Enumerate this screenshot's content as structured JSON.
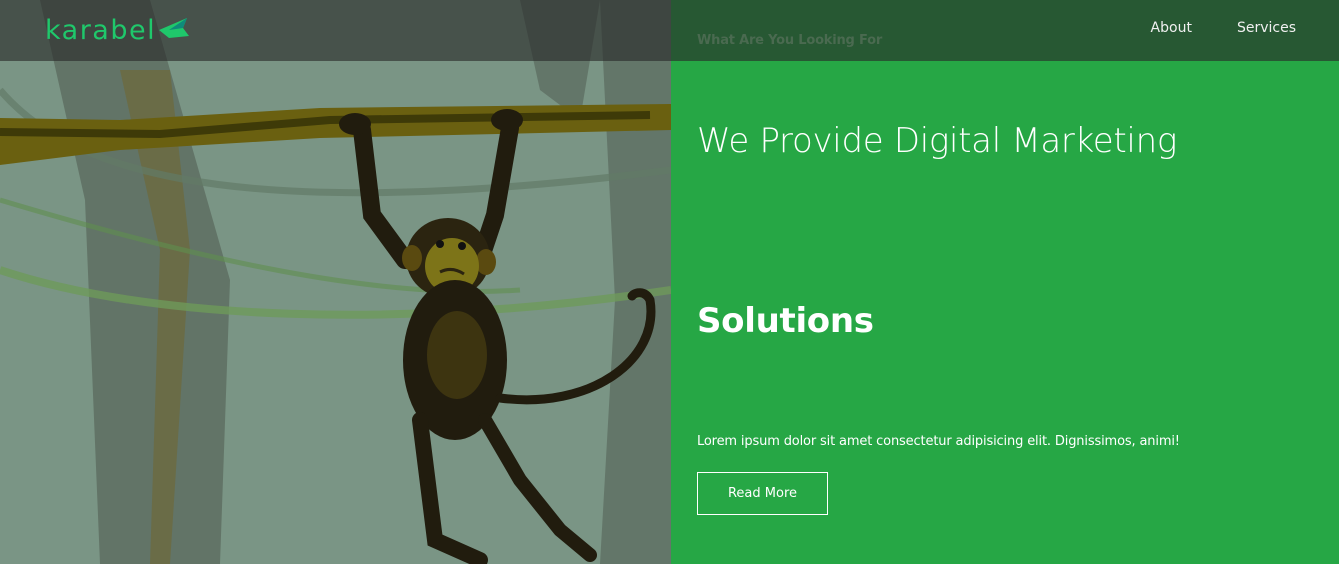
{
  "brand": {
    "name": "karabel",
    "icon": "graduation-cap-icon",
    "color": "#1fc86b"
  },
  "search": {
    "placeholder": "What Are You Looking For"
  },
  "nav": {
    "items": [
      {
        "label": "About"
      },
      {
        "label": "Services"
      }
    ]
  },
  "hero": {
    "headline_line1": "We Provide Digital Marketing",
    "headline_line2": "Solutions",
    "body": "Lorem ipsum dolor sit amet consectetur adipisicing elit. Dignissimos, animi!",
    "cta_label": "Read More",
    "image_subject": "monkey-hanging-from-branch-illustration",
    "accent_color": "#26a745"
  }
}
